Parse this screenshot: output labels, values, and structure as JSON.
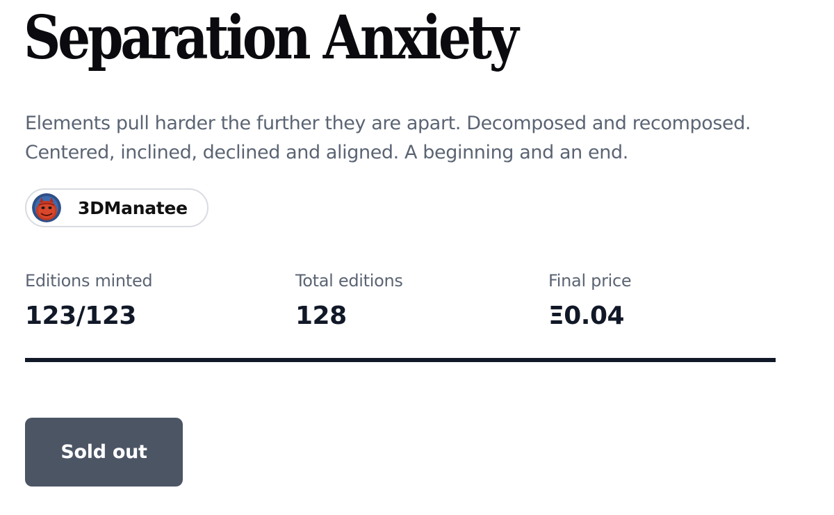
{
  "title": "Separation Anxiety",
  "description": {
    "line1": "Elements pull harder the further they are apart. Decomposed and recomposed.",
    "line2": "Centered, inclined, declined and aligned. A beginning and an end."
  },
  "artist": {
    "name": "3DManatee",
    "avatar_icon": "devil-face-avatar"
  },
  "stats": [
    {
      "label": "Editions minted",
      "value": "123/123"
    },
    {
      "label": "Total editions",
      "value": "128"
    },
    {
      "label": "Final price",
      "value": "Ξ0.04"
    }
  ],
  "button": {
    "label": "Sold out"
  },
  "colors": {
    "text_primary": "#111827",
    "text_secondary": "#5b6473",
    "button_bg": "#4c5564",
    "divider": "#111827"
  }
}
